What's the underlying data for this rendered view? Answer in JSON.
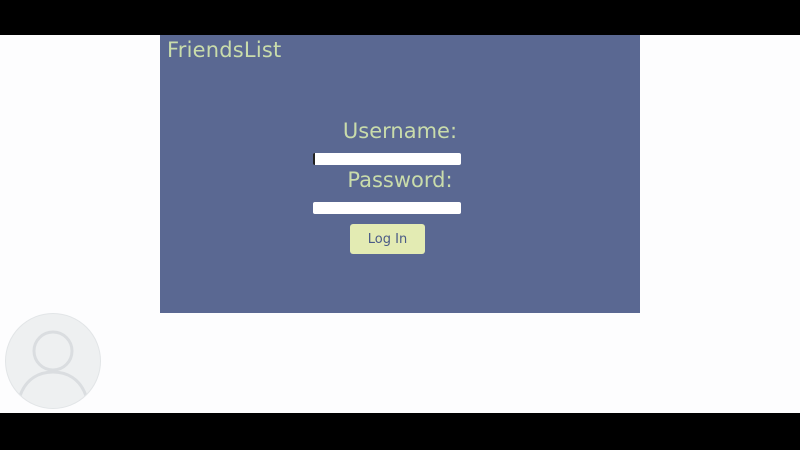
{
  "app": {
    "title": "FriendsList"
  },
  "login_form": {
    "username_label": "Username:",
    "username_value": "",
    "password_label": "Password:",
    "password_value": "",
    "login_button_label": "Log In"
  },
  "avatar": {
    "icon": "user-silhouette-icon"
  },
  "colors": {
    "panel_background": "#5a6892",
    "label_text": "#c9dcab",
    "button_background": "#e3ebb3",
    "page_background": "#fdfdfe",
    "letterbox": "#000000"
  }
}
